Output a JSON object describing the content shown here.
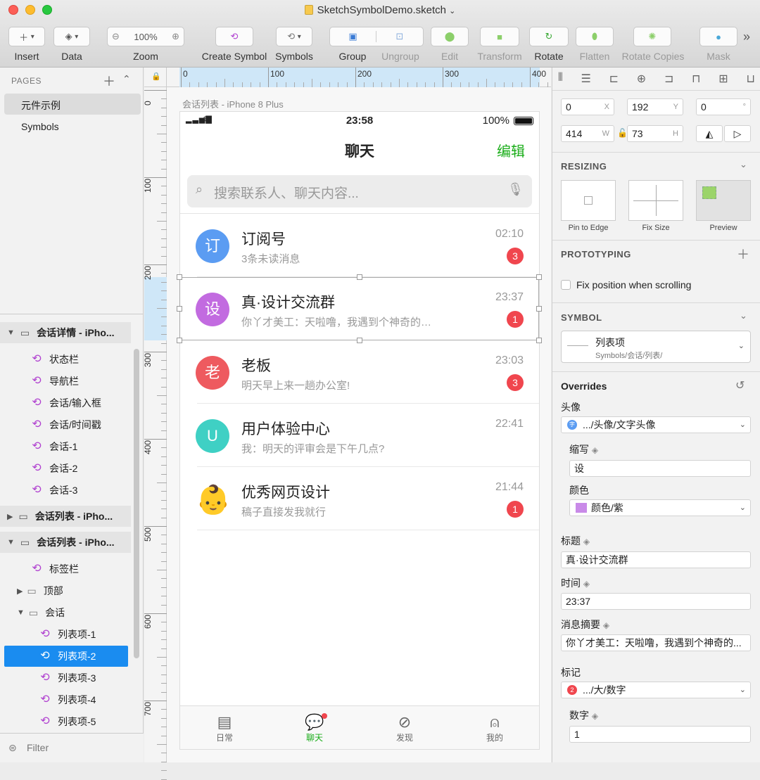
{
  "window": {
    "title": "SketchSymbolDemo.sketch"
  },
  "toolbar": {
    "insert": "Insert",
    "data": "Data",
    "zoom_label": "Zoom",
    "zoom_value": "100%",
    "create_symbol": "Create Symbol",
    "symbols": "Symbols",
    "group": "Group",
    "ungroup": "Ungroup",
    "edit": "Edit",
    "transform": "Transform",
    "rotate": "Rotate",
    "flatten": "Flatten",
    "rotate_copies": "Rotate Copies",
    "mask": "Mask"
  },
  "pages": {
    "header": "PAGES",
    "items": [
      "元件示例",
      "Symbols"
    ]
  },
  "layers": {
    "artboard1": "会话详情 - iPho...",
    "artboard1_items": [
      "状态栏",
      "导航栏",
      "会话/输入框",
      "会话/时间戳",
      "会话-1",
      "会话-2",
      "会话-3"
    ],
    "artboard2": "会话列表 - iPho...",
    "artboard3": "会话列表 - iPho...",
    "artboard3_items": [
      "标签栏",
      "顶部",
      "会话"
    ],
    "list_items": [
      "列表项-1",
      "列表项-2",
      "列表项-3",
      "列表项-4",
      "列表项-5"
    ],
    "filter": "Filter"
  },
  "ruler": {
    "h": [
      "0",
      "100",
      "200",
      "300",
      "400"
    ],
    "v": [
      "0",
      "100",
      "200",
      "300",
      "400",
      "500",
      "600",
      "700"
    ]
  },
  "artboard": {
    "label": "会话列表 - iPhone 8 Plus",
    "status_time": "23:58",
    "battery": "100%",
    "nav_title": "聊天",
    "nav_edit": "编辑",
    "search_placeholder": "搜索联系人、聊天内容...",
    "rows": [
      {
        "avatar": "订",
        "color": "#5b9cf2",
        "title": "订阅号",
        "sub": "3条未读消息",
        "time": "02:10",
        "badge": "3"
      },
      {
        "avatar": "设",
        "color": "#c26be0",
        "title": "真·设计交流群",
        "sub": "你丫才美工：天啦噜，我遇到个神奇的…",
        "time": "23:37",
        "badge": "1"
      },
      {
        "avatar": "老",
        "color": "#ee5a5f",
        "title": "老板",
        "sub": "明天早上来一趟办公室!",
        "time": "23:03",
        "badge": "3"
      },
      {
        "avatar": "U",
        "color": "#3fd0c4",
        "title": "用户体验中心",
        "sub": "我：明天的评审会是下午几点?",
        "time": "22:41",
        "badge": ""
      },
      {
        "avatar": "👶",
        "color": "#ffffff",
        "title": "优秀网页设计",
        "sub": "稿子直接发我就行",
        "time": "21:44",
        "badge": "1"
      }
    ],
    "tabs": [
      "日常",
      "聊天",
      "发现",
      "我的"
    ],
    "colors": {
      "accent": "#1aad19",
      "badge": "#f0464e"
    }
  },
  "inspector": {
    "x": "0",
    "y": "192",
    "rotation": "0",
    "w": "414",
    "h": "73",
    "x_unit": "X",
    "y_unit": "Y",
    "rot_unit": "°",
    "w_unit": "W",
    "h_unit": "H",
    "resizing": "RESIZING",
    "pin": "Pin to Edge",
    "fix": "Fix Size",
    "preview": "Preview",
    "prototyping": "PROTOTYPING",
    "fix_position": "Fix position when scrolling",
    "symbol": "SYMBOL",
    "symbol_name": "列表项",
    "symbol_path": "Symbols/会话/列表/",
    "overrides": "Overrides",
    "avatar_label": "头像",
    "avatar_value": ".../头像/文字头像",
    "avatar_chip": "字",
    "abbr_label": "缩写",
    "abbr_value": "设",
    "color_label": "颜色",
    "color_value": "颜色/紫",
    "title_label": "标题",
    "title_value": "真·设计交流群",
    "time_label": "时间",
    "time_value": "23:37",
    "summary_label": "消息摘要",
    "summary_value": "你丫才美工：天啦噜，我遇到个神奇的...",
    "mark_label": "标记",
    "mark_value": ".../大/数字",
    "mark_chip": "2",
    "number_label": "数字",
    "number_value": "1"
  }
}
